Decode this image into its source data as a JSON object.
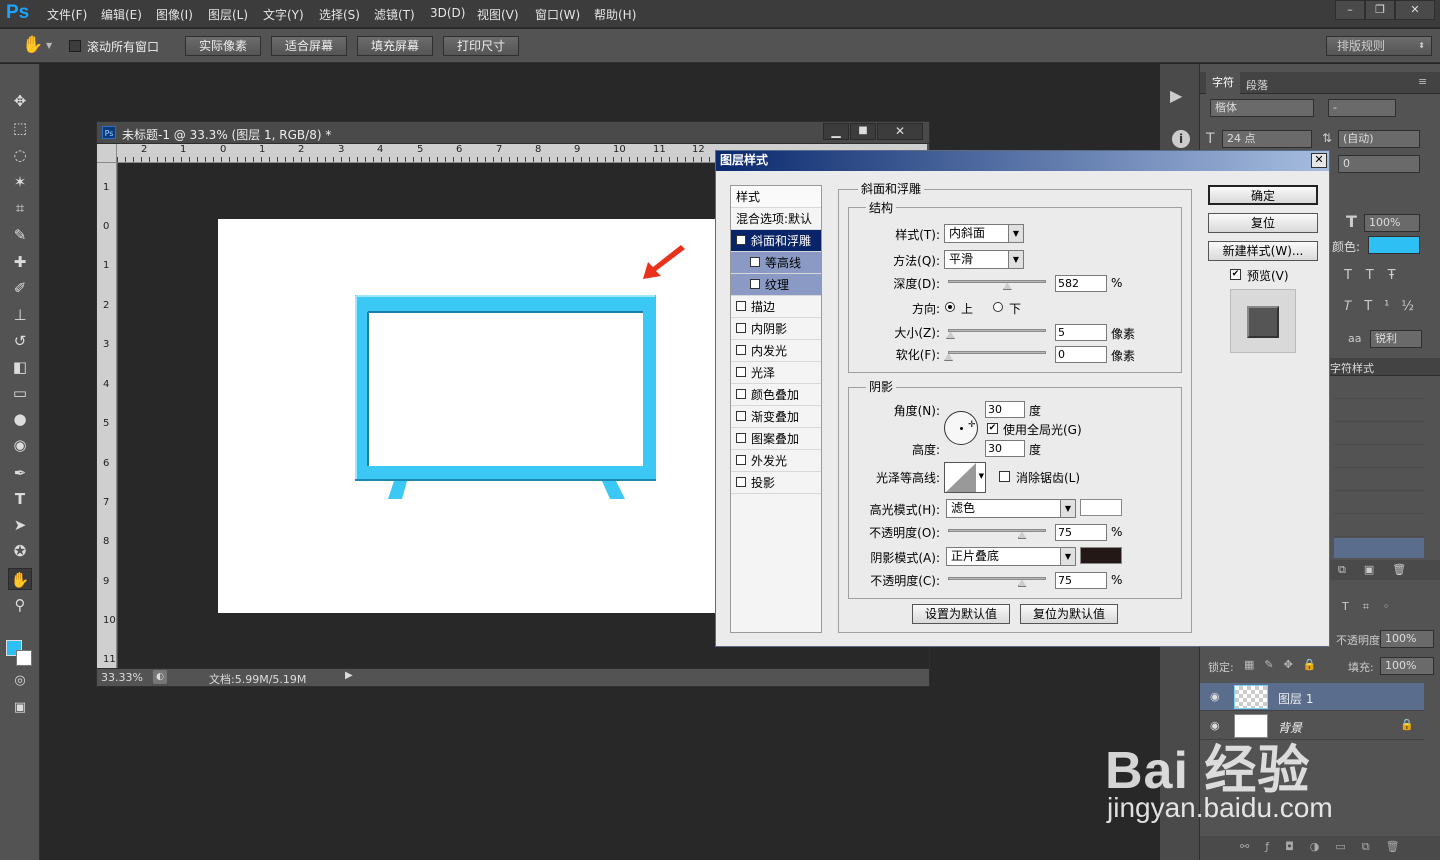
{
  "app": {
    "logo": "Ps"
  },
  "menu": [
    "文件(F)",
    "编辑(E)",
    "图像(I)",
    "图层(L)",
    "文字(Y)",
    "选择(S)",
    "滤镜(T)",
    "3D(D)",
    "视图(V)",
    "窗口(W)",
    "帮助(H)"
  ],
  "window_controls": [
    "–",
    "❐",
    "✕"
  ],
  "options": {
    "scroll_all_label": "滚动所有窗口",
    "buttons": [
      "实际像素",
      "适合屏幕",
      "填充屏幕",
      "打印尺寸"
    ],
    "workspace": "排版规则"
  },
  "document": {
    "title": "未标题-1 @ 33.3% (图层 1, RGB/8) *",
    "zoom": "33.33%",
    "doc_size": "文档:5.99M/5.19M",
    "ruler_h": [
      "2",
      "1",
      "0",
      "1",
      "2",
      "3",
      "4",
      "5",
      "6",
      "7",
      "8",
      "9",
      "10",
      "11",
      "12"
    ],
    "ruler_v": [
      "1",
      "0",
      "1",
      "2",
      "3",
      "4",
      "5",
      "6",
      "7",
      "8",
      "9",
      "10",
      "11"
    ],
    "shape_color": "#3cc8f4",
    "arrow_color": "#e8321c"
  },
  "character_panel": {
    "tabs": [
      "字符",
      "段落"
    ],
    "font_family": "楷体",
    "font_style": "-",
    "font_size": "24 点",
    "leading": "(自动)",
    "tracking": "0",
    "scale": "100%",
    "color_label": "颜色:",
    "color": "#2ec0f4",
    "antialias_label": "aa",
    "antialias": "锐利",
    "char_styles_tab": "字符样式"
  },
  "layers_panel": {
    "opacity_label": "不透明度:",
    "opacity": "100%",
    "lock_label": "锁定:",
    "fill_label": "填充:",
    "fill": "100%",
    "layers": [
      {
        "name": "图层 1"
      },
      {
        "name": "背景"
      }
    ]
  },
  "dialog": {
    "title": "图层样式",
    "close": "✕",
    "styles_header": "样式",
    "blend_default": "混合选项:默认",
    "style_items": [
      {
        "label": "斜面和浮雕",
        "checked": true,
        "selected": true,
        "indent": false
      },
      {
        "label": "等高线",
        "checked": false,
        "selected": false,
        "indent": true
      },
      {
        "label": "纹理",
        "checked": false,
        "selected": false,
        "indent": true
      },
      {
        "label": "描边",
        "checked": false,
        "selected": false,
        "indent": false
      },
      {
        "label": "内阴影",
        "checked": false,
        "selected": false,
        "indent": false
      },
      {
        "label": "内发光",
        "checked": false,
        "selected": false,
        "indent": false
      },
      {
        "label": "光泽",
        "checked": false,
        "selected": false,
        "indent": false
      },
      {
        "label": "颜色叠加",
        "checked": false,
        "selected": false,
        "indent": false
      },
      {
        "label": "渐变叠加",
        "checked": false,
        "selected": false,
        "indent": false
      },
      {
        "label": "图案叠加",
        "checked": false,
        "selected": false,
        "indent": false
      },
      {
        "label": "外发光",
        "checked": false,
        "selected": false,
        "indent": false
      },
      {
        "label": "投影",
        "checked": false,
        "selected": false,
        "indent": false
      }
    ],
    "bevel_title": "斜面和浮雕",
    "structure_title": "结构",
    "style_label": "样式(T):",
    "style_value": "内斜面",
    "technique_label": "方法(Q):",
    "technique_value": "平滑",
    "depth_label": "深度(D):",
    "depth_value": "582",
    "depth_level": 0.6,
    "percent": "%",
    "direction_label": "方向:",
    "dir_up": "上",
    "dir_down": "下",
    "size_label": "大小(Z):",
    "size_value": "5",
    "size_level": 0.02,
    "soften_label": "软化(F):",
    "soften_value": "0",
    "soften_level": 0,
    "pixels": "像素",
    "shading_title": "阴影",
    "angle_label": "角度(N):",
    "angle_value": "30",
    "degree": "度",
    "global_light": "使用全局光(G)",
    "altitude_label": "高度:",
    "altitude_value": "30",
    "gloss_label": "光泽等高线:",
    "antialiased": "消除锯齿(L)",
    "highlight_mode_label": "高光模式(H):",
    "highlight_mode": "滤色",
    "highlight_color": "#ffffff",
    "highlight_opacity_label": "不透明度(O):",
    "highlight_opacity": "75",
    "highlight_opacity_level": 0.75,
    "shadow_mode_label": "阴影模式(A):",
    "shadow_mode": "正片叠底",
    "shadow_color": "#231815",
    "shadow_opacity_label": "不透明度(C):",
    "shadow_opacity": "75",
    "shadow_opacity_level": 0.75,
    "make_default": "设置为默认值",
    "reset_default": "复位为默认值",
    "ok": "确定",
    "reset": "复位",
    "new_style": "新建样式(W)...",
    "preview_label": "预览(V)"
  },
  "watermark": {
    "brand": "Bai 经验",
    "url": "jingyan.baidu.com"
  }
}
